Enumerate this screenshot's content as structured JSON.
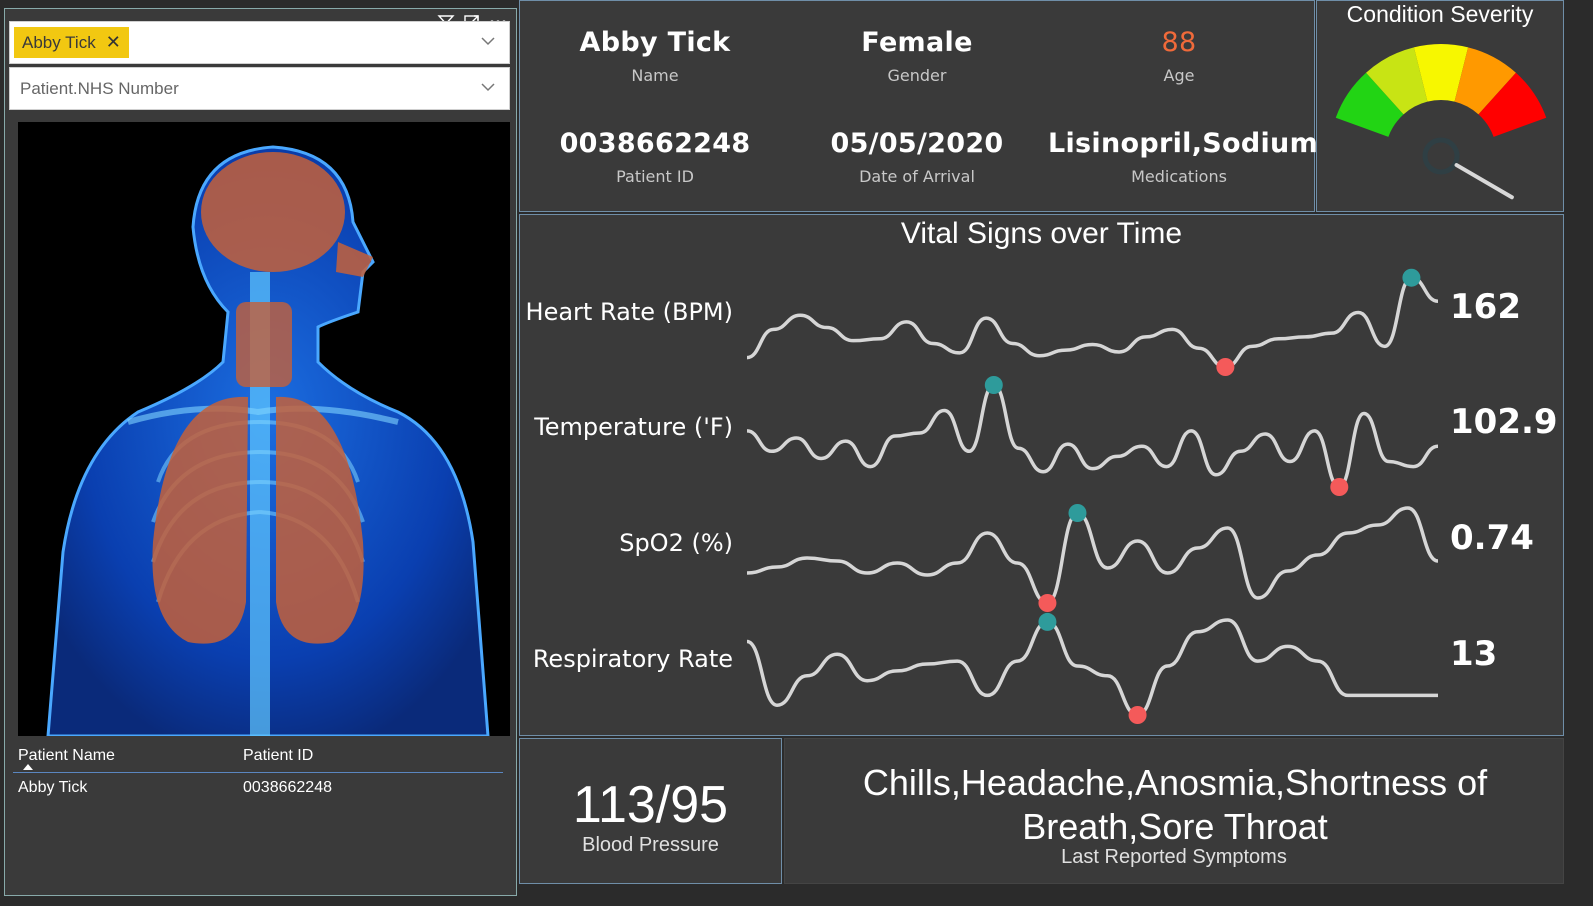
{
  "slicers": {
    "patient_chip": "Abby Tick",
    "nhs_placeholder": "Patient.NHS Number"
  },
  "patient_table": {
    "headers": [
      "Patient Name",
      "Patient ID"
    ],
    "rows": [
      [
        "Abby Tick",
        "0038662248"
      ]
    ]
  },
  "info": {
    "name": {
      "value": "Abby Tick",
      "label": "Name"
    },
    "gender": {
      "value": "Female",
      "label": "Gender"
    },
    "age": {
      "value": "88",
      "label": "Age"
    },
    "patient_id": {
      "value": "0038662248",
      "label": "Patient ID"
    },
    "arrival": {
      "value": "05/05/2020",
      "label": "Date of Arrival"
    },
    "medications": {
      "value": "Lisinopril,Sodium ...",
      "label": "Medications"
    }
  },
  "gauge": {
    "title": "Condition Severity",
    "level": 0.93,
    "bands": [
      "#22d414",
      "#c8e414",
      "#f7f700",
      "#ff9900",
      "#ff0000"
    ]
  },
  "vitals": {
    "title": "Vital Signs over Time",
    "rows": [
      {
        "label": "Heart Rate (BPM)",
        "value": "162",
        "series": [
          10,
          40,
          55,
          42,
          28,
          30,
          48,
          25,
          15,
          52,
          25,
          12,
          18,
          24,
          16,
          32,
          40,
          20,
          0,
          22,
          30,
          32,
          36,
          58,
          22,
          95,
          70
        ],
        "max": 25,
        "min": 18
      },
      {
        "label": "Temperature ('F)",
        "value": "102.9",
        "series": [
          55,
          35,
          48,
          28,
          45,
          20,
          50,
          53,
          75,
          35,
          100,
          38,
          15,
          42,
          18,
          30,
          40,
          20,
          55,
          12,
          35,
          52,
          25,
          55,
          0,
          72,
          25,
          20,
          40
        ],
        "max": 10,
        "min": 24
      },
      {
        "label": "SpO2 (%)",
        "value": "0.74",
        "series": [
          30,
          36,
          45,
          42,
          30,
          40,
          28,
          40,
          70,
          40,
          0,
          90,
          35,
          62,
          30,
          55,
          75,
          5,
          32,
          48,
          70,
          78,
          95,
          42
        ],
        "max": 11,
        "min": 10
      },
      {
        "label": "Respiratory Rate",
        "value": "13",
        "series": [
          75,
          10,
          40,
          62,
          35,
          45,
          52,
          55,
          20,
          55,
          95,
          50,
          40,
          0,
          50,
          85,
          97,
          55,
          70,
          55,
          20,
          20,
          20,
          20
        ],
        "max": 10,
        "min": 13
      }
    ],
    "colors": {
      "line": "#d6d6d6",
      "max": "#2e9b9b",
      "min": "#f45a5a"
    }
  },
  "blood_pressure": {
    "value": "113/95",
    "label": "Blood Pressure"
  },
  "symptoms": {
    "value": "Chills,Headache,Anosmia,Shortness of Breath,Sore Throat",
    "label": "Last Reported Symptoms"
  },
  "colors": {
    "background": "#2b2b2b",
    "card": "#3a3a3a",
    "age_accent": "#f06a3a",
    "chip": "#f2c811"
  }
}
